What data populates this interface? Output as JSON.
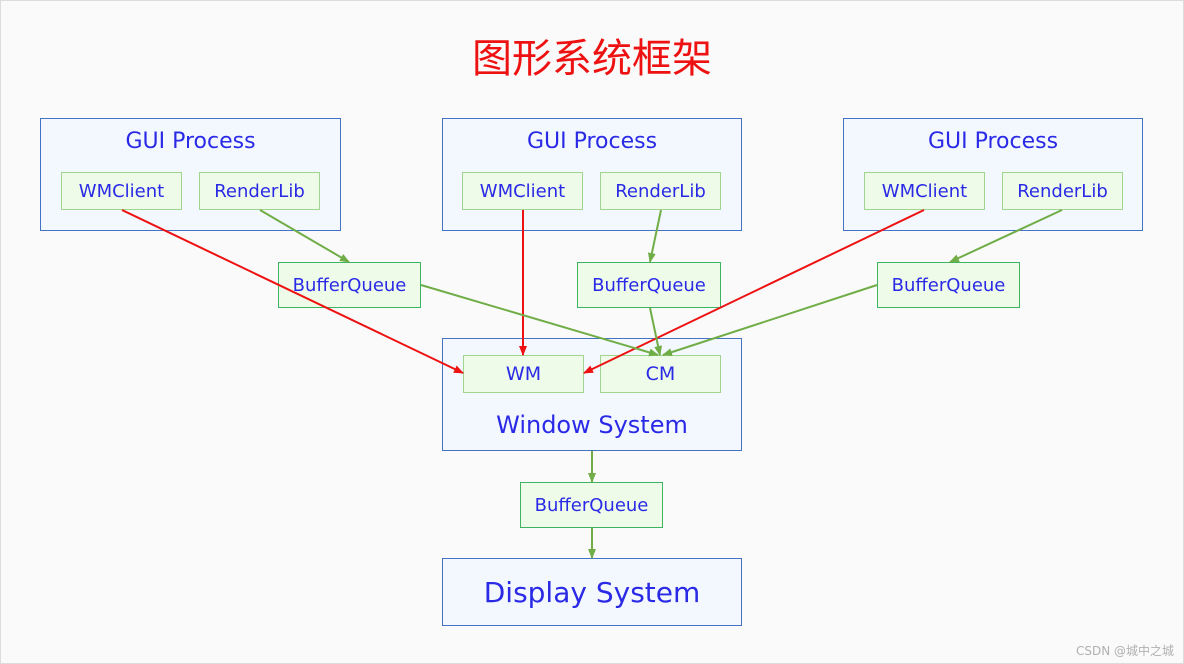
{
  "title": "图形系统框架",
  "gui_processes": [
    {
      "label": "GUI Process",
      "wmclient": "WMClient",
      "renderlib": "RenderLib",
      "bufferqueue": "BufferQueue"
    },
    {
      "label": "GUI Process",
      "wmclient": "WMClient",
      "renderlib": "RenderLib",
      "bufferqueue": "BufferQueue"
    },
    {
      "label": "GUI Process",
      "wmclient": "WMClient",
      "renderlib": "RenderLib",
      "bufferqueue": "BufferQueue"
    }
  ],
  "window_system": {
    "label": "Window System",
    "wm": "WM",
    "cm": "CM"
  },
  "output_bufferqueue": "BufferQueue",
  "display_system": "Display System",
  "colors": {
    "title": "#ee1111",
    "text": "#2a2ae6",
    "control_arrow": "#ee1111",
    "buffer_arrow": "#70ad47"
  },
  "watermark": "CSDN @城中之城"
}
